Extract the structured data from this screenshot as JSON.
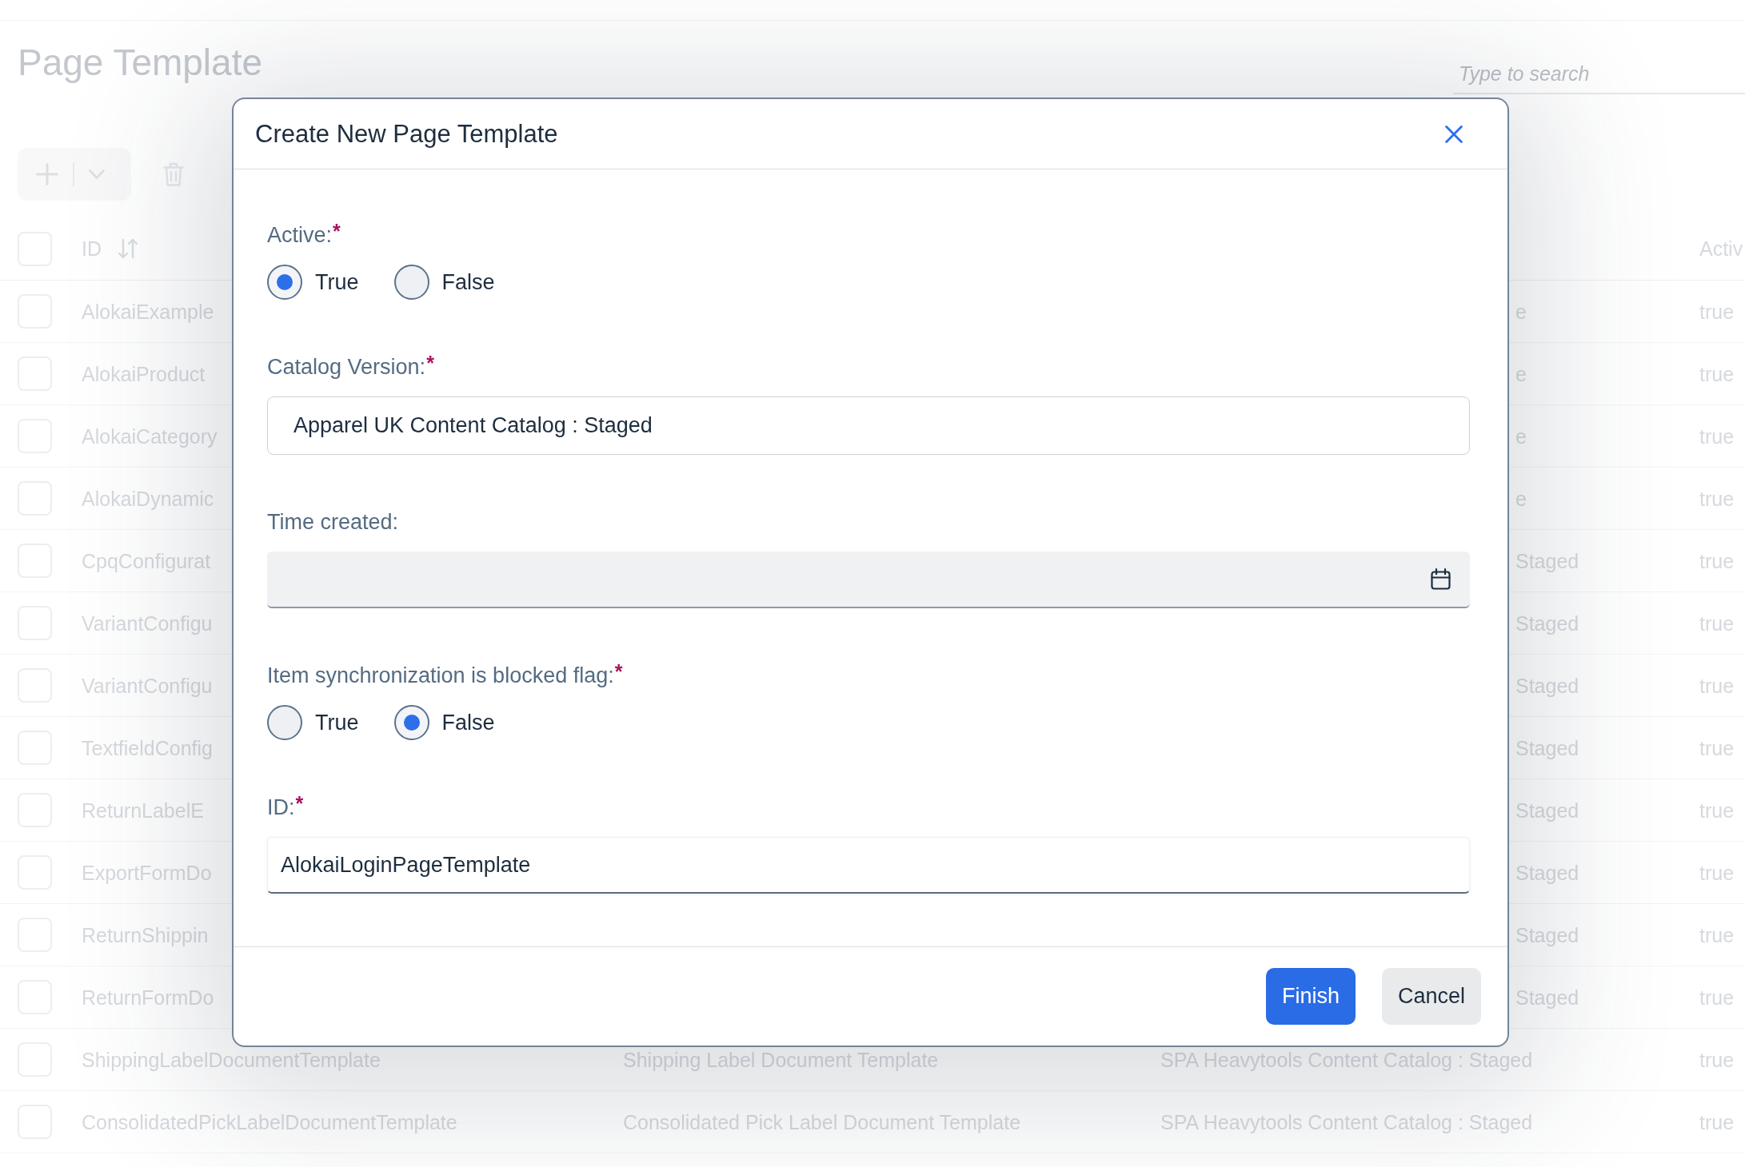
{
  "page": {
    "title": "Page Template",
    "search": {
      "placeholder": "Type to search"
    }
  },
  "table": {
    "header": {
      "checked": false,
      "column_1": "ID",
      "column_4": "Activ"
    },
    "rows": [
      {
        "checked": false,
        "column_1": "AlokaiExample",
        "column_3": "e",
        "column_4": "true"
      },
      {
        "checked": false,
        "column_1": "AlokaiProduct",
        "column_3": "e",
        "column_4": "true"
      },
      {
        "checked": false,
        "column_1": "AlokaiCategory",
        "column_3": "e",
        "column_4": "true"
      },
      {
        "checked": false,
        "column_1": "AlokaiDynamic",
        "column_3": "e",
        "column_4": "true"
      },
      {
        "checked": false,
        "column_1": "CpqConfigurat",
        "column_3": "Staged",
        "column_4": "true"
      },
      {
        "checked": false,
        "column_1": "VariantConfigu",
        "column_3": "Staged",
        "column_4": "true"
      },
      {
        "checked": false,
        "column_1": "VariantConfigu",
        "column_3": "Staged",
        "column_4": "true"
      },
      {
        "checked": false,
        "column_1": "TextfieldConfig",
        "column_3": "Staged",
        "column_4": "true"
      },
      {
        "checked": false,
        "column_1": "ReturnLabelE",
        "column_3": "Staged",
        "column_4": "true"
      },
      {
        "checked": false,
        "column_1": "ExportFormDo",
        "column_3": "Staged",
        "column_4": "true"
      },
      {
        "checked": false,
        "column_1": "ReturnShippin",
        "column_3": "Staged",
        "column_4": "true"
      },
      {
        "checked": false,
        "column_1": "ReturnFormDo",
        "column_3": "Staged",
        "column_4": "true"
      },
      {
        "checked": false,
        "column_1": "ShippingLabelDocumentTemplate",
        "column_2": "Shipping Label Document Template",
        "column_3": "SPA Heavytools Content Catalog : Staged",
        "column_4": "true"
      },
      {
        "checked": false,
        "column_1": "ConsolidatedPickLabelDocumentTemplate",
        "column_2": "Consolidated Pick Label Document Template",
        "column_3": "SPA Heavytools Content Catalog : Staged",
        "column_4": "true"
      }
    ]
  },
  "dialog": {
    "title": "Create New Page Template",
    "fields": [
      {
        "kind": "radio",
        "label": "Active:",
        "mark": "*",
        "options": [
          {
            "label": "True",
            "selected": true
          },
          {
            "label": "False",
            "selected": false
          }
        ]
      },
      {
        "kind": "display",
        "label": "Catalog Version:",
        "mark": "*",
        "value": "Apparel UK Content Catalog : Staged"
      },
      {
        "kind": "date",
        "label": "Time created:"
      },
      {
        "kind": "radio",
        "label": "Item synchronization is blocked flag:",
        "mark": "*",
        "options": [
          {
            "label": "True",
            "selected": false
          },
          {
            "label": "False",
            "selected": true
          }
        ]
      },
      {
        "kind": "text",
        "label": "ID:",
        "mark": "*",
        "value": "AlokaiLoginPageTemplate"
      }
    ],
    "buttons": [
      {
        "kind": "primary",
        "label": "Finish"
      },
      {
        "kind": "secondary",
        "label": "Cancel"
      }
    ]
  }
}
